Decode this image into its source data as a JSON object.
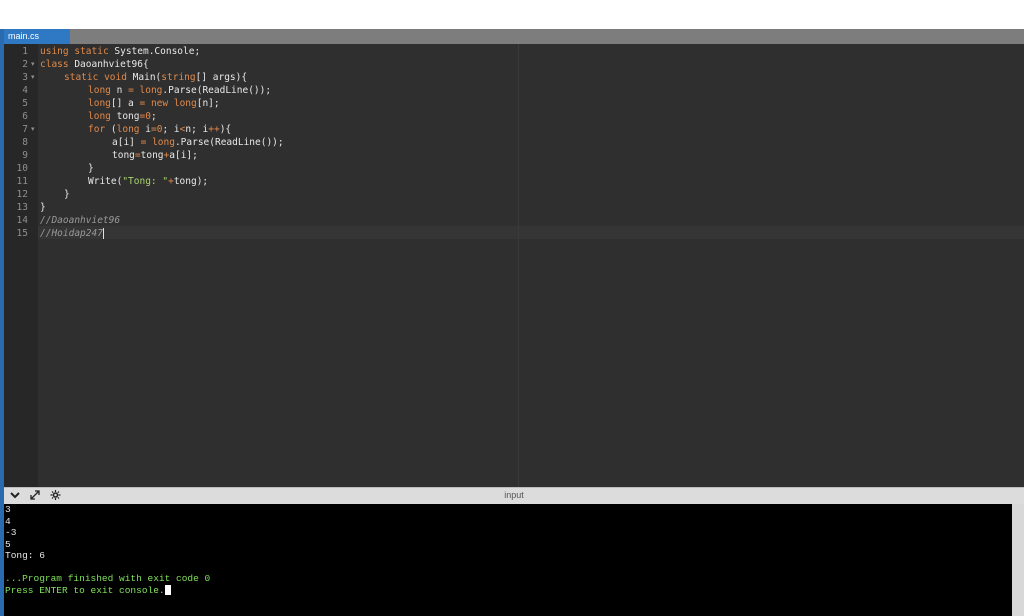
{
  "tab": {
    "filename": "main.cs"
  },
  "editor": {
    "line_numbers": [
      "1",
      "2",
      "3",
      "4",
      "5",
      "6",
      "7",
      "8",
      "9",
      "10",
      "11",
      "12",
      "13",
      "14",
      "15"
    ],
    "lines": {
      "l1": {
        "kw1": "using",
        "kw2": "static",
        "rest": " System.Console;"
      },
      "l2": {
        "kw": "class",
        "rest": " Daoanhviet96{"
      },
      "l3": {
        "kw1": "static",
        "kw2": "void",
        "name": " Main(",
        "ty": "string",
        "rest": "[] args){"
      },
      "l4": {
        "ty1": "long",
        "a": " n ",
        "op": "=",
        "ty2": " long",
        "rest": ".Parse(ReadLine());"
      },
      "l5": {
        "ty1": "long",
        "a": "[] a ",
        "op": "=",
        "kw": " new",
        "ty2": " long",
        "rest": "[n];"
      },
      "l6": {
        "ty": "long",
        "a": " tong",
        "op": "=",
        "num": "0",
        "rest": ";"
      },
      "l7": {
        "kw": "for",
        "a": " (",
        "ty": "long",
        "b": " i",
        "op1": "=",
        "num": "0",
        "c": "; i",
        "op2": "<",
        "d": "n; i",
        "op3": "++",
        "rest": "){"
      },
      "l8": {
        "a": "a[i] ",
        "op": "=",
        "ty": " long",
        "rest": ".Parse(ReadLine());"
      },
      "l9": {
        "a": "tong",
        "op1": "=",
        "b": "tong",
        "op2": "+",
        "rest": "a[i];"
      },
      "l10": {
        "text": "}"
      },
      "l11": {
        "a": "Write(",
        "str": "\"Tong: \"",
        "op": "+",
        "rest": "tong);"
      },
      "l12": {
        "text": "}"
      },
      "l13": {
        "text": "}"
      },
      "l14": {
        "comment": "//Daoanhviet96"
      },
      "l15": {
        "comment": "//Hoidap247"
      }
    }
  },
  "console": {
    "label": "input",
    "toolbar_icons": [
      "chevron-down-icon",
      "expand-icon",
      "settings-icon"
    ],
    "lines": [
      "3",
      "4",
      "-3",
      "5",
      "Tong: 6",
      "",
      "...Program finished with exit code 0",
      "Press ENTER to exit console."
    ]
  }
}
